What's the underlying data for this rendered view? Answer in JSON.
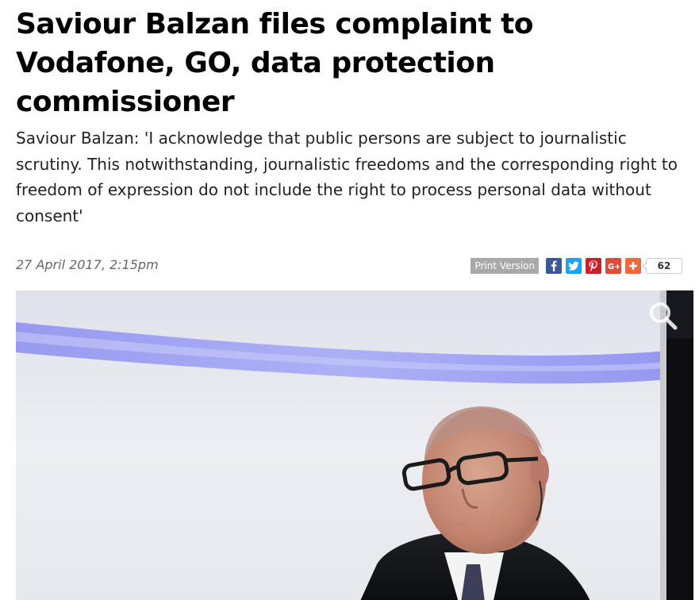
{
  "article": {
    "headline": "Saviour Balzan files complaint to Vodafone, GO, data protection commissioner",
    "standfirst": "Saviour Balzan: 'I acknowledge that public persons are subject to journalistic scrutiny. This notwithstanding, journalistic freedoms and the corresponding right to freedom of expression do not include the right to process personal data without consent'",
    "date": "27 April 2017, 2:15pm"
  },
  "share_bar": {
    "print_label": "Print Version",
    "buttons": [
      {
        "icon": "facebook-icon",
        "glyph": "f",
        "color": "#3b5998"
      },
      {
        "icon": "twitter-icon",
        "glyph": "t",
        "color": "#1da1f2"
      },
      {
        "icon": "pinterest-icon",
        "glyph": "P",
        "color": "#cb2027"
      },
      {
        "icon": "google-plus-icon",
        "glyph": "G+",
        "color": "#dd4b39"
      },
      {
        "icon": "more-share-icon",
        "glyph": "+",
        "color": "#f0683a"
      }
    ],
    "share_count": "62"
  },
  "photo": {
    "zoom_icon": "magnifier-icon"
  }
}
